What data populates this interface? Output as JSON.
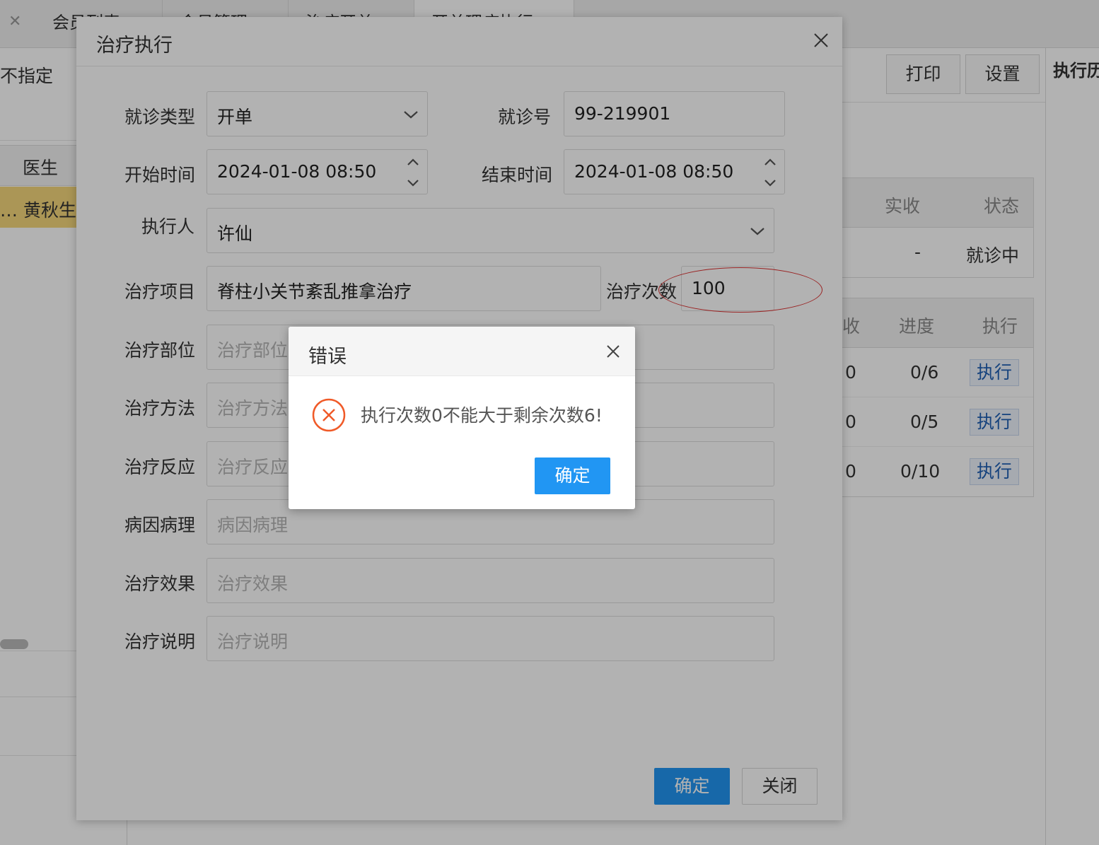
{
  "background": {
    "tabs": [
      "会员列表",
      "会员管理",
      "治疗开单",
      "开单理疗执行"
    ],
    "left_panel": {
      "filter_label": "不指定",
      "col_header": "医生",
      "row_text": "… 黄秋生"
    },
    "toolbar": {
      "print": "打印",
      "settings": "设置"
    },
    "history_title": "执行历",
    "visit_table": {
      "headers": [
        "实收",
        "状态"
      ],
      "row": [
        "-",
        "就诊中"
      ]
    },
    "exec_table": {
      "headers": [
        "收",
        "进度",
        "执行"
      ],
      "rows": [
        {
          "paid": "0",
          "progress": "0/6",
          "action": "执行"
        },
        {
          "paid": "0",
          "progress": "0/5",
          "action": "执行"
        },
        {
          "paid": "0",
          "progress": "0/10",
          "action": "执行"
        }
      ]
    }
  },
  "modal": {
    "title": "治疗执行",
    "fields": {
      "visit_type": {
        "label": "就诊类型",
        "value": "开单"
      },
      "visit_no": {
        "label": "就诊号",
        "value": "99-219901"
      },
      "start_time": {
        "label": "开始时间",
        "value": "2024-01-08 08:50"
      },
      "end_time": {
        "label": "结束时间",
        "value": "2024-01-08 08:50"
      },
      "executor": {
        "label": "执行人",
        "value": "许仙"
      },
      "item": {
        "label": "治疗项目",
        "value": "脊柱小关节紊乱推拿治疗"
      },
      "count": {
        "label": "治疗次数",
        "value": "100"
      },
      "site": {
        "label": "治疗部位",
        "placeholder": "治疗部位"
      },
      "method": {
        "label": "治疗方法",
        "placeholder": "治疗方法"
      },
      "reaction": {
        "label": "治疗反应",
        "placeholder": "治疗反应"
      },
      "etiology": {
        "label": "病因病理",
        "placeholder": "病因病理"
      },
      "effect": {
        "label": "治疗效果",
        "placeholder": "治疗效果"
      },
      "notes": {
        "label": "治疗说明",
        "placeholder": "治疗说明"
      }
    },
    "confirm": "确定",
    "close": "关闭"
  },
  "error_dialog": {
    "title": "错误",
    "message": "执行次数0不能大于剩余次数6!",
    "confirm": "确定"
  },
  "colors": {
    "primary": "#2196f3",
    "error": "#f05a28",
    "highlight_row": "#f5d77b",
    "annotation": "#dd3333"
  }
}
